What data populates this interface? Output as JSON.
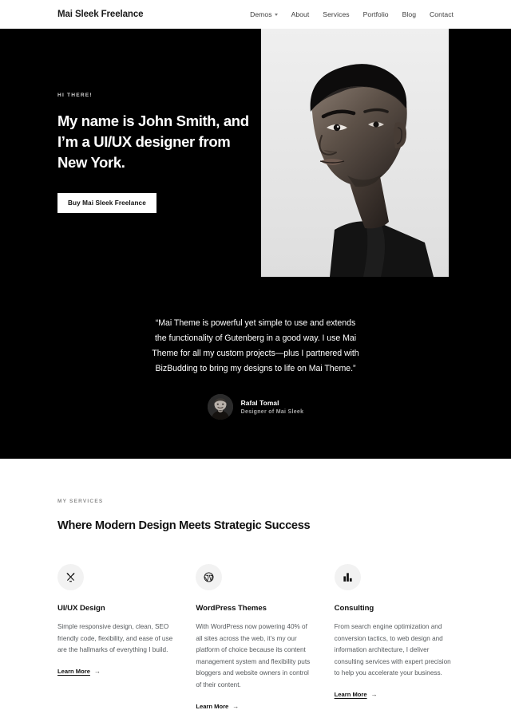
{
  "header": {
    "site_title": "Mai Sleek Freelance",
    "nav": [
      {
        "label": "Demos",
        "has_dropdown": true
      },
      {
        "label": "About",
        "has_dropdown": false
      },
      {
        "label": "Services",
        "has_dropdown": false
      },
      {
        "label": "Portfolio",
        "has_dropdown": false
      },
      {
        "label": "Blog",
        "has_dropdown": false
      },
      {
        "label": "Contact",
        "has_dropdown": false
      }
    ]
  },
  "hero": {
    "eyebrow": "HI THERE!",
    "title": "My name is John Smith, and I’m a UI/UX designer from New York.",
    "button_label": "Buy Mai Sleek Freelance",
    "image_alt": "portrait-photo",
    "background_color": "#000000"
  },
  "testimonial": {
    "quote": "“Mai Theme is powerful yet simple to use and extends the functionality of Gutenberg in a good way. I use Mai Theme for all my custom projects—plus I partnered with BizBudding to bring my designs to life on Mai Theme.”",
    "author_name": "Rafal Tomal",
    "author_role": "Designer of Mai Sleek",
    "background_color": "#000000"
  },
  "services": {
    "eyebrow": "MY SERVICES",
    "title": "Where Modern Design Meets Strategic Success",
    "cards": [
      {
        "icon": "pen-ruler-icon",
        "title": "UI/UX Design",
        "body": "Simple responsive design, clean, SEO friendly code, flexibility, and ease of use are the hallmarks of everything I build.",
        "link_label": "Learn More",
        "link_arrow": "→"
      },
      {
        "icon": "wordpress-icon",
        "title": "WordPress Themes",
        "body": "With WordPress now powering 40% of all sites across the web, it’s my our platform of choice because its content management system and flexibility puts bloggers and website owners in control of their content.",
        "link_label": "Learn More",
        "link_arrow": "→"
      },
      {
        "icon": "bar-chart-icon",
        "title": "Consulting",
        "body": "From search engine optimization and conversion tactics, to web design and information architecture, I deliver consulting services with expert precision to help you accelerate your business.",
        "link_label": "Learn More",
        "link_arrow": "→"
      }
    ]
  }
}
